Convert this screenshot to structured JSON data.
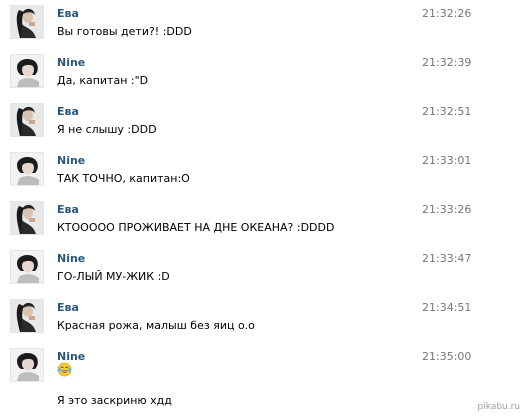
{
  "messages": [
    {
      "author": "Ева",
      "avatar": "eva-avatar",
      "time": "21:32:26",
      "text": "Вы готовы дети?! :DDD"
    },
    {
      "author": "Nine",
      "avatar": "nine-avatar",
      "time": "21:32:39",
      "text": "Да, капитан :\"D"
    },
    {
      "author": "Ева",
      "avatar": "eva-avatar",
      "time": "21:32:51",
      "text": "Я не слышу :DDD"
    },
    {
      "author": "Nine",
      "avatar": "nine-avatar",
      "time": "21:33:01",
      "text": "ТАК ТОЧНО, капитан:О"
    },
    {
      "author": "Ева",
      "avatar": "eva-avatar",
      "time": "21:33:26",
      "text": "КТООООО ПРОЖИВАЕТ НА ДНЕ ОКЕАНА? :DDDD"
    },
    {
      "author": "Nine",
      "avatar": "nine-avatar",
      "time": "21:33:47",
      "text": "ГО-ЛЫЙ МУ-ЖИК :D"
    },
    {
      "author": "Ева",
      "avatar": "eva-avatar",
      "time": "21:34:51",
      "text": "Красная рожа, малыш без яиц о.о"
    },
    {
      "author": "Nine",
      "avatar": "nine-avatar",
      "time": "21:35:00",
      "emoji": "laughing-tears-emoji",
      "text": "Я это заскриню хдд"
    }
  ],
  "watermark": "pikabu.ru"
}
